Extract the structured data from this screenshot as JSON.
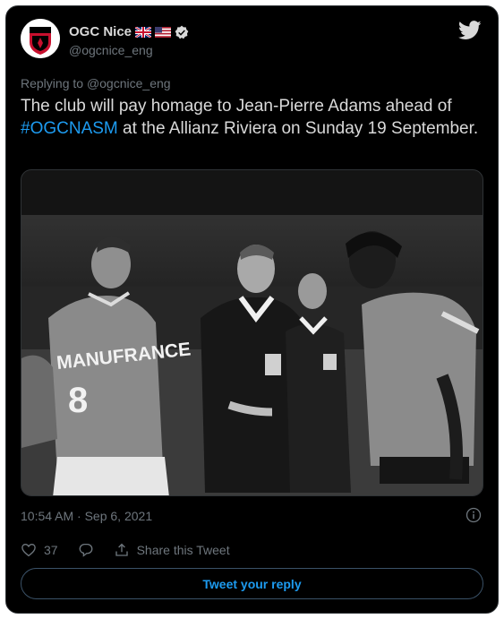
{
  "colors": {
    "background": "#000000",
    "text": "#d9d9d9",
    "muted": "#6e767d",
    "accent": "#1d9bf0",
    "border": "#2f3336"
  },
  "author": {
    "name": "OGC Nice",
    "handle": "@ogcnice_eng",
    "flags": [
      "uk-flag-icon",
      "us-flag-icon"
    ],
    "verified_icon": "verified-badge-icon",
    "avatar_icon": "ogc-nice-crest",
    "platform_icon": "twitter-bird-icon"
  },
  "replying": {
    "prefix": "Replying to",
    "mention": "@ogcnice_eng"
  },
  "tweet": {
    "text_before": "The club will pay homage to Jean-Pierre Adams ahead of ",
    "hashtag": "#OGCNASM",
    "text_after": " at the Allianz Riviera on Sunday 19 September."
  },
  "media": {
    "type": "black-and-white photo",
    "jersey_text": "MANUFRANCE",
    "jersey_number": "8"
  },
  "meta": {
    "timestamp": "10:54 AM · Sep 6, 2021",
    "info_icon": "info-icon"
  },
  "actions": {
    "likes": "37",
    "share_label": "Share this Tweet"
  },
  "reply_button": {
    "label": "Tweet your reply"
  }
}
